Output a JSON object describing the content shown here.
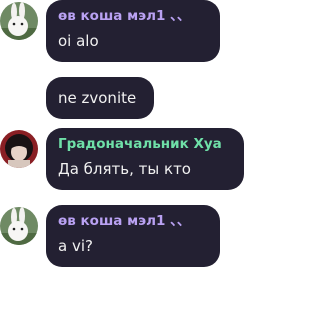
{
  "colors": {
    "bubble_bg": "#232032",
    "name_purple": "#b9a1f2",
    "name_green": "#6fe0a8",
    "text": "#f1f1f1"
  },
  "messages": [
    {
      "author": "өв коша мэл1 、、",
      "text": "oi alo",
      "avatar": "white-rabbit-avatar"
    },
    {
      "author": "",
      "text": "ne zvonite",
      "avatar": ""
    },
    {
      "author": "Градоначальник Хуа",
      "text": "Да блять, ты кто",
      "avatar": "dark-hair-anime-avatar"
    },
    {
      "author": "өв коша мэл1 、、",
      "text": "a vi?",
      "avatar": "white-rabbit-avatar"
    }
  ]
}
